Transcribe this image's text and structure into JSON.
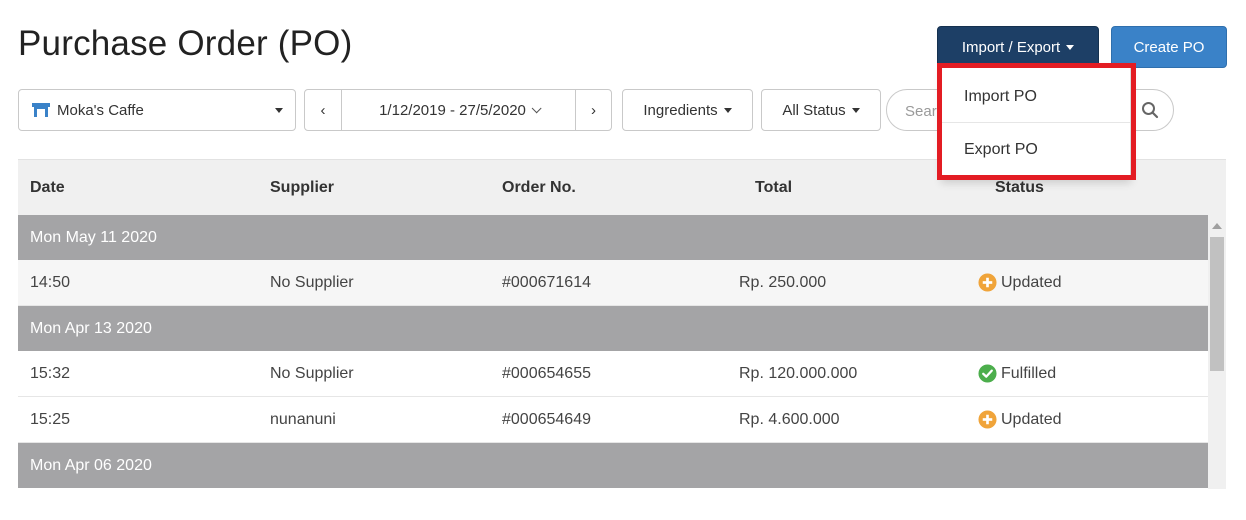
{
  "page": {
    "title": "Purchase Order (PO)"
  },
  "header": {
    "import_export_label": "Import / Export",
    "create_label": "Create PO"
  },
  "filters": {
    "outlet": "Moka's Caffe",
    "date_range": "1/12/2019 - 27/5/2020",
    "prev_label": "‹",
    "next_label": "›",
    "category": "Ingredients",
    "status": "All Status",
    "search_placeholder": "Search"
  },
  "dropdown": {
    "items": [
      {
        "label": "Import PO"
      },
      {
        "label": "Export PO"
      }
    ]
  },
  "table": {
    "columns": [
      "Date",
      "Supplier",
      "Order No.",
      "Total",
      "Status"
    ],
    "groups": [
      {
        "date": "Mon May 11 2020",
        "rows": [
          {
            "time": "14:50",
            "supplier": "No Supplier",
            "order_no": "#000671614",
            "total": "Rp. 250.000",
            "status": "Updated"
          }
        ]
      },
      {
        "date": "Mon Apr 13 2020",
        "rows": [
          {
            "time": "15:32",
            "supplier": "No Supplier",
            "order_no": "#000654655",
            "total": "Rp. 120.000.000",
            "status": "Fulfilled"
          },
          {
            "time": "15:25",
            "supplier": "nunanuni",
            "order_no": "#000654649",
            "total": "Rp. 4.600.000",
            "status": "Updated"
          }
        ]
      },
      {
        "date": "Mon Apr 06 2020",
        "rows": []
      }
    ]
  },
  "colors": {
    "primary_dark": "#1d3f66",
    "primary": "#3a82c8",
    "group_row": "#a4a4a6",
    "status_updated": "#f0a43a",
    "status_fulfilled": "#4cae4c",
    "highlight": "#e31c23"
  },
  "icons": {
    "outlet": "store-icon",
    "search": "search-icon",
    "updated": "plus-circle-icon",
    "fulfilled": "check-circle-icon"
  }
}
